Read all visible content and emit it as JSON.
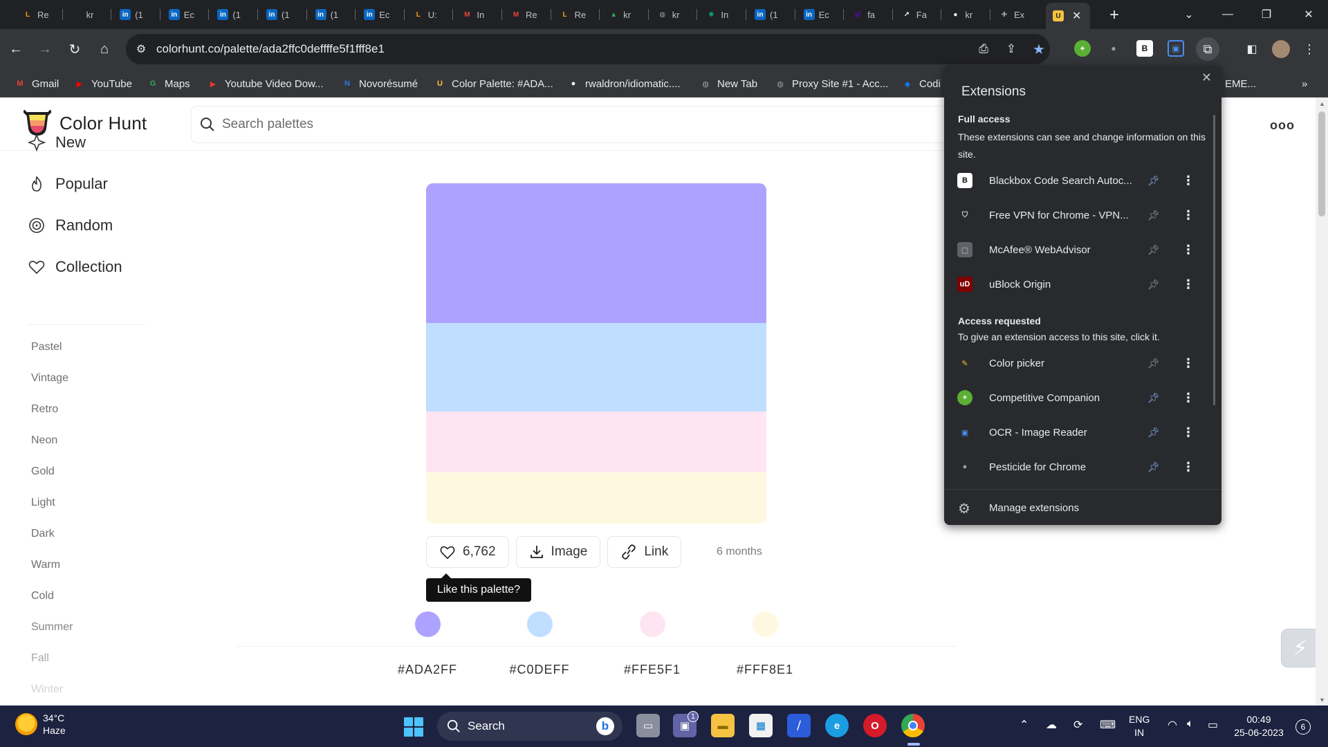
{
  "browser": {
    "tabs": [
      {
        "title": "Re",
        "icon": "leetcode-icon",
        "color": "#f89f1b"
      },
      {
        "title": "kr",
        "icon": "blank-icon",
        "color": "#5f6368"
      },
      {
        "title": "(1",
        "icon": "linkedin-icon",
        "color": "#0a66c2"
      },
      {
        "title": "Ec",
        "icon": "linkedin-icon",
        "color": "#0a66c2"
      },
      {
        "title": "(1",
        "icon": "linkedin-icon",
        "color": "#0a66c2"
      },
      {
        "title": "(1",
        "icon": "linkedin-icon",
        "color": "#0a66c2"
      },
      {
        "title": "(1",
        "icon": "linkedin-icon",
        "color": "#0a66c2"
      },
      {
        "title": "Ec",
        "icon": "linkedin-icon",
        "color": "#0a66c2"
      },
      {
        "title": "U:",
        "icon": "leetcode-icon",
        "color": "#f89f1b"
      },
      {
        "title": "In",
        "icon": "gmail-icon",
        "color": "#ea4335"
      },
      {
        "title": "Re",
        "icon": "gmail-icon",
        "color": "#ea4335"
      },
      {
        "title": "Re",
        "icon": "leetcode-icon",
        "color": "#f89f1b"
      },
      {
        "title": "kr",
        "icon": "drive-icon",
        "color": "#34a853"
      },
      {
        "title": "kr",
        "icon": "globe-icon",
        "color": "#9aa0a6"
      },
      {
        "title": "In",
        "icon": "chatgpt-icon",
        "color": "#10a37f"
      },
      {
        "title": "(1",
        "icon": "linkedin-icon",
        "color": "#0a66c2"
      },
      {
        "title": "Ec",
        "icon": "linkedin-icon",
        "color": "#0a66c2"
      },
      {
        "title": "fa",
        "icon": "yahoo-icon",
        "color": "#6001d2"
      },
      {
        "title": "Fa",
        "icon": "chart-icon",
        "color": "#ffffff"
      },
      {
        "title": "kr",
        "icon": "github-icon",
        "color": "#ffffff"
      },
      {
        "title": "Ex",
        "icon": "puzzle-icon",
        "color": "#9aa0a6"
      }
    ],
    "active_tab_icon": "color-hunt-icon",
    "url": "colorhunt.co/palette/ada2ffc0deffffe5f1fff8e1",
    "bookmarks": [
      {
        "label": "Gmail",
        "icon": "gmail-icon",
        "color": "#ea4335"
      },
      {
        "label": "YouTube",
        "icon": "youtube-icon",
        "color": "#ff0000"
      },
      {
        "label": "Maps",
        "icon": "maps-icon",
        "color": "#34a853"
      },
      {
        "label": "Youtube Video Dow...",
        "icon": "download-icon",
        "color": "#e53935"
      },
      {
        "label": "Novorésumé",
        "icon": "novoresume-icon",
        "color": "#2c7be5"
      },
      {
        "label": "Color Palette: #ADA...",
        "icon": "color-hunt-icon",
        "color": "#f6c23e"
      },
      {
        "label": "rwaldron/idiomatic....",
        "icon": "github-icon",
        "color": "#ffffff"
      },
      {
        "label": "New Tab",
        "icon": "globe-icon",
        "color": "#9aa0a6"
      },
      {
        "label": "Proxy Site #1 - Acc...",
        "icon": "globe-icon",
        "color": "#9aa0a6"
      },
      {
        "label": "Codi",
        "icon": "codi-icon",
        "color": "#1a73e8"
      },
      {
        "label": "EME...",
        "icon": "blank-icon",
        "color": "#5f6368"
      }
    ],
    "more_bookmarks": "»"
  },
  "site": {
    "name": "Color Hunt",
    "search_placeholder": "Search palettes",
    "nav": [
      {
        "label": "New",
        "icon": "sparkle-icon"
      },
      {
        "label": "Popular",
        "icon": "flame-icon"
      },
      {
        "label": "Random",
        "icon": "spiral-icon"
      },
      {
        "label": "Collection",
        "icon": "heart-icon"
      }
    ],
    "tags": [
      "Pastel",
      "Vintage",
      "Retro",
      "Neon",
      "Gold",
      "Light",
      "Dark",
      "Warm",
      "Cold",
      "Summer",
      "Fall",
      "Winter"
    ],
    "more_menu": "ooo"
  },
  "palette": {
    "colors": [
      {
        "hex": "#ADA2FF",
        "value": "#ada2ff"
      },
      {
        "hex": "#C0DEFF",
        "value": "#c0deff"
      },
      {
        "hex": "#FFE5F1",
        "value": "#ffe5f1"
      },
      {
        "hex": "#FFF8E1",
        "value": "#fff8e1"
      }
    ],
    "likes": "6,762",
    "image_label": "Image",
    "link_label": "Link",
    "age": "6 months",
    "tooltip": "Like this palette?"
  },
  "extensions": {
    "title": "Extensions",
    "full_access_heading": "Full access",
    "full_access_desc": "These extensions can see and change information on this site.",
    "full_access": [
      {
        "name": "Blackbox Code Search Autoc...",
        "icon": "blackbox-icon",
        "pinned": true
      },
      {
        "name": "Free VPN for Chrome - VPN...",
        "icon": "shield-icon",
        "pinned": false
      },
      {
        "name": "McAfee® WebAdvisor",
        "icon": "mcafee-icon",
        "pinned": false
      },
      {
        "name": "uBlock Origin",
        "icon": "ublock-icon",
        "pinned": false
      }
    ],
    "requested_heading": "Access requested",
    "requested_desc": "To give an extension access to this site, click it.",
    "requested": [
      {
        "name": "Color picker",
        "icon": "eyedropper-icon",
        "pinned": false
      },
      {
        "name": "Competitive Companion",
        "icon": "plus-circle-icon",
        "pinned": true
      },
      {
        "name": "OCR - Image Reader",
        "icon": "ocr-icon",
        "pinned": true
      },
      {
        "name": "Pesticide for Chrome",
        "icon": "bug-icon",
        "pinned": true
      }
    ],
    "manage_label": "Manage extensions"
  },
  "taskbar": {
    "temperature": "34°C",
    "condition": "Haze",
    "search_label": "Search",
    "teams_badge": "1",
    "language": "ENG",
    "region": "IN",
    "time": "00:49",
    "date": "25-06-2023",
    "notifications": "6"
  }
}
